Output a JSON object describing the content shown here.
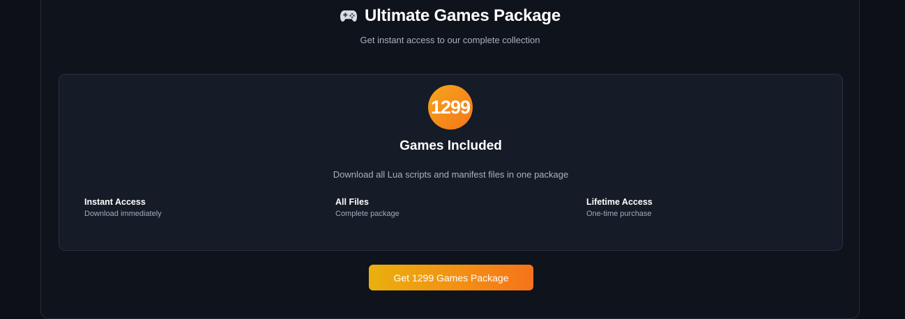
{
  "header": {
    "icon": "gamepad-icon",
    "title": "Ultimate Games Package",
    "subtitle": "Get instant access to our complete collection"
  },
  "package": {
    "count": "1299",
    "heading": "Games Included",
    "description": "Download all Lua scripts and manifest files in one package",
    "features": [
      {
        "title": "Instant Access",
        "description": "Download immediately"
      },
      {
        "title": "All Files",
        "description": "Complete package"
      },
      {
        "title": "Lifetime Access",
        "description": "One-time purchase"
      }
    ]
  },
  "cta": {
    "label": "Get 1299 Games Package"
  },
  "colors": {
    "background": "#0d1017",
    "card": "#151b27",
    "accent_start": "#e9b00d",
    "accent_end": "#f6731b",
    "muted_text": "#a9b2c1"
  }
}
